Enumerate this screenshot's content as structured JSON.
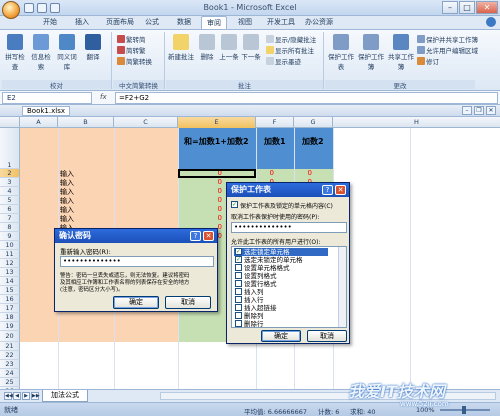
{
  "window": {
    "title": "Book1 - Microsoft Excel",
    "minimize": "–",
    "maximize": "□",
    "close": "✕"
  },
  "ribbon_tabs": [
    "开始",
    "插入",
    "页面布局",
    "公式",
    "数据",
    "审阅",
    "视图",
    "开发工具",
    "办公资源"
  ],
  "active_tab": "审阅",
  "ribbon": {
    "proofing": {
      "label": "校对",
      "buttons": [
        "拼写检查",
        "信息检索",
        "同义词库",
        "翻译"
      ]
    },
    "chinese": {
      "label": "中文简繁转换",
      "buttons": [
        "繁转简",
        "简转繁",
        "简繁转换"
      ]
    },
    "comments": {
      "label": "批注",
      "buttons": [
        "新建批注",
        "删除",
        "上一条",
        "下一条"
      ],
      "small": [
        "显示/隐藏批注",
        "显示所有批注",
        "显示墨迹"
      ]
    },
    "changes": {
      "label": "更改",
      "buttons": [
        "保护工作表",
        "保护工作簿",
        "共享工作簿"
      ],
      "small": [
        "保护并共享工作簿",
        "允许用户编辑区域",
        "修订"
      ]
    }
  },
  "formula_bar": {
    "name_box": "E2",
    "fx": "fx",
    "formula": "=F2+G2"
  },
  "workbook": {
    "title": "Book1.xlsx",
    "min": "–",
    "restore": "❐",
    "close": "✕"
  },
  "grid": {
    "columns": [
      "A",
      "B",
      "C",
      "D",
      "E",
      "F",
      "G",
      "H"
    ],
    "rows": [
      "1",
      "2",
      "3",
      "4",
      "5",
      "6",
      "7",
      "8",
      "9",
      "10",
      "11",
      "12",
      "13",
      "14",
      "15",
      "16",
      "17",
      "18",
      "19",
      "20",
      "21",
      "22",
      "23",
      "24",
      "25",
      "26"
    ],
    "header_e": "和=加数1+加数2",
    "header_f": "加数1",
    "header_g": "加数2",
    "input_labels": [
      "输入",
      "输入",
      "输入",
      "输入",
      "输入",
      "输入",
      "输入",
      "输入",
      "输入"
    ],
    "e_values": [
      "0",
      "0",
      "0",
      "0",
      "0",
      "0",
      "0",
      "0"
    ],
    "f_values": [
      "0",
      "0"
    ],
    "g_values": [
      "0",
      "0"
    ]
  },
  "confirm_dialog": {
    "title": "确认密码",
    "prompt": "重新输入密码(R):",
    "password": "••••••••••••••",
    "warning_1": "警告：密码一旦丢失或遗忘，则无法恢复。建议将密码",
    "warning_2": "及其相应工作簿和工作表名称的列表保存在安全的地方",
    "warning_3": "(注意，密码区分大小写)。",
    "ok": "确定",
    "cancel": "取消"
  },
  "protect_dialog": {
    "title": "保护工作表",
    "protect_checkbox": "保护工作表及锁定的单元格内容(C)",
    "password_label": "取消工作表保护时使用的密码(P):",
    "password": "••••••••••••••",
    "allow_label": "允许此工作表的所有用户进行(O):",
    "options": [
      "选定锁定单元格",
      "选定未锁定的单元格",
      "设置单元格格式",
      "设置列格式",
      "设置行格式",
      "插入列",
      "插入行",
      "插入超链接",
      "删除列",
      "删除行"
    ],
    "ok": "确定",
    "cancel": "取消"
  },
  "sheet_tabs": {
    "nav": [
      "◀◀",
      "◀",
      "▶",
      "▶▶"
    ],
    "active": "加法公式"
  },
  "status": {
    "ready": "就绪",
    "average": "平均值: 6.66666667",
    "count": "计数: 6",
    "sum": "求和: 40",
    "zoom": "100%"
  },
  "watermark": {
    "text": "我爱IT技术网",
    "url": "www.52ij.com"
  },
  "colors": {
    "ribbon_bg": "#dde8f5",
    "peach": "#fbd4b4",
    "header_blue": "#4f8fd1",
    "green": "#c6e0b4",
    "dialog_title": "#1c4fb8"
  }
}
